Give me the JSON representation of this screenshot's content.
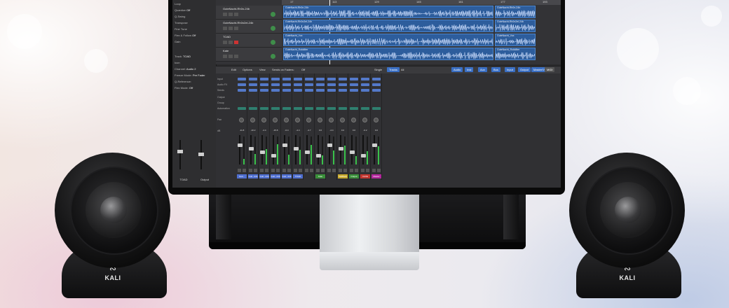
{
  "scene": {
    "speaker_brand": "KALI",
    "speaker_mark_icon": "kali-wave-logo"
  },
  "daw": {
    "inspector": [
      {
        "label": "Loop",
        "value": ""
      },
      {
        "label": "Quantize",
        "value": "Off"
      },
      {
        "label": "Q-Swing",
        "value": ""
      },
      {
        "label": "Transpose",
        "value": ""
      },
      {
        "label": "Fine Tune",
        "value": ""
      },
      {
        "label": "Flex & Follow",
        "value": "Off"
      },
      {
        "label": "Gain",
        "value": ""
      },
      {
        "label": "Track:",
        "value": "TOAD"
      },
      {
        "label": "Icon",
        "value": ""
      },
      {
        "label": "Channel:",
        "value": "Audio 2"
      },
      {
        "label": "Freeze Mode:",
        "value": "Pre Fader"
      },
      {
        "label": "Q-Reference:",
        "value": ""
      },
      {
        "label": "Flex Mode:",
        "value": "Off"
      }
    ],
    "ruler_ticks": [
      "17",
      "113",
      "129",
      "145",
      "161",
      "177",
      "193"
    ],
    "tracks": [
      {
        "name": "GuteNacht-Rh0n-24b",
        "region_top": "GuteNacht-Rh0n-24b",
        "region_right": "GuteNacht-Rh0n-24b"
      },
      {
        "name": "GuteNacht-Rh0n2el-24b",
        "region_top": "GuteNacht-Rh0n2el-24b",
        "region_right": "GuteNacht-Rh0n2el-24b"
      },
      {
        "name": "TOAD",
        "region_top": "GuteNacht_Vox",
        "region_right": "GuteNacht_Vox"
      },
      {
        "name": "Kate",
        "region_top": "GuteNacht_Rokkilter",
        "region_right": "GuteNacht_Rokkilter"
      }
    ],
    "mixer_toolbar": {
      "edit": "Edit",
      "options": "Options",
      "view": "View",
      "sends": "Sends on Faders:",
      "sends_value": "Off",
      "single": "Single",
      "tracks": "Tracks",
      "all": "All",
      "filters": [
        "Audio",
        "Inst",
        "Aux",
        "Bus",
        "Input",
        "Output",
        "Master/VCA",
        "MIDI"
      ]
    },
    "row_labels": [
      "Input",
      "Audio FX",
      "Sends",
      "Output",
      "Group",
      "Automation",
      "Pan",
      "dB"
    ],
    "channel_names": [
      "Guit...",
      "Guit...24b",
      "Guit...24b",
      "Guit...24b",
      "Guit...24b",
      "TOAD",
      "",
      "Kate",
      "",
      "TalkBack",
      "Output",
      "CAVE",
      "Master"
    ],
    "channel_colors": [
      "#4f6fd0",
      "#4f6fd0",
      "#4f6fd0",
      "#4f6fd0",
      "#4f6fd0",
      "#4f6fd0",
      "#303033",
      "#3a8f3a",
      "#303033",
      "#c7a82a",
      "#3a8f3a",
      "#c2362f",
      "#b3269c"
    ],
    "left_strips": [
      {
        "name": "TOAD"
      },
      {
        "name": "Output"
      }
    ],
    "db_values": [
      "-11.8",
      "-10.2",
      "-4.4",
      "-15.8",
      "-0.4",
      "-4.4",
      "-4.7",
      "0.0",
      "-4.4",
      "0.0",
      "0.0",
      "-0.2",
      "0.0"
    ]
  }
}
